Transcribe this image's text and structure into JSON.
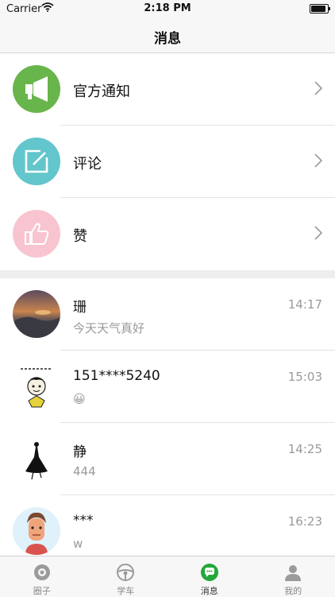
{
  "status_bar": {
    "carrier": "Carrier",
    "time": "2:18 PM"
  },
  "nav": {
    "title": "消息"
  },
  "system_items": [
    {
      "label": "官方通知",
      "icon": "megaphone-icon",
      "color": "#67b54b"
    },
    {
      "label": "评论",
      "icon": "edit-icon",
      "color": "#62c6cc"
    },
    {
      "label": "赞",
      "icon": "thumbs-up-icon",
      "color": "#f8c4d0"
    }
  ],
  "chats": [
    {
      "name": "珊",
      "time": "14:17",
      "message": "今天天气真好"
    },
    {
      "name": "151****5240",
      "time": "15:03",
      "message": "😀"
    },
    {
      "name": "静",
      "time": "14:25",
      "message": "444"
    },
    {
      "name": "***",
      "time": "16:23",
      "message": "w"
    }
  ],
  "tabs": [
    {
      "label": "圈子",
      "icon": "circle-community-icon",
      "active": false
    },
    {
      "label": "学车",
      "icon": "steering-wheel-icon",
      "active": false
    },
    {
      "label": "消息",
      "icon": "chat-bubble-icon",
      "active": true,
      "color": "#22a83a"
    },
    {
      "label": "我的",
      "icon": "person-icon",
      "active": false
    }
  ]
}
